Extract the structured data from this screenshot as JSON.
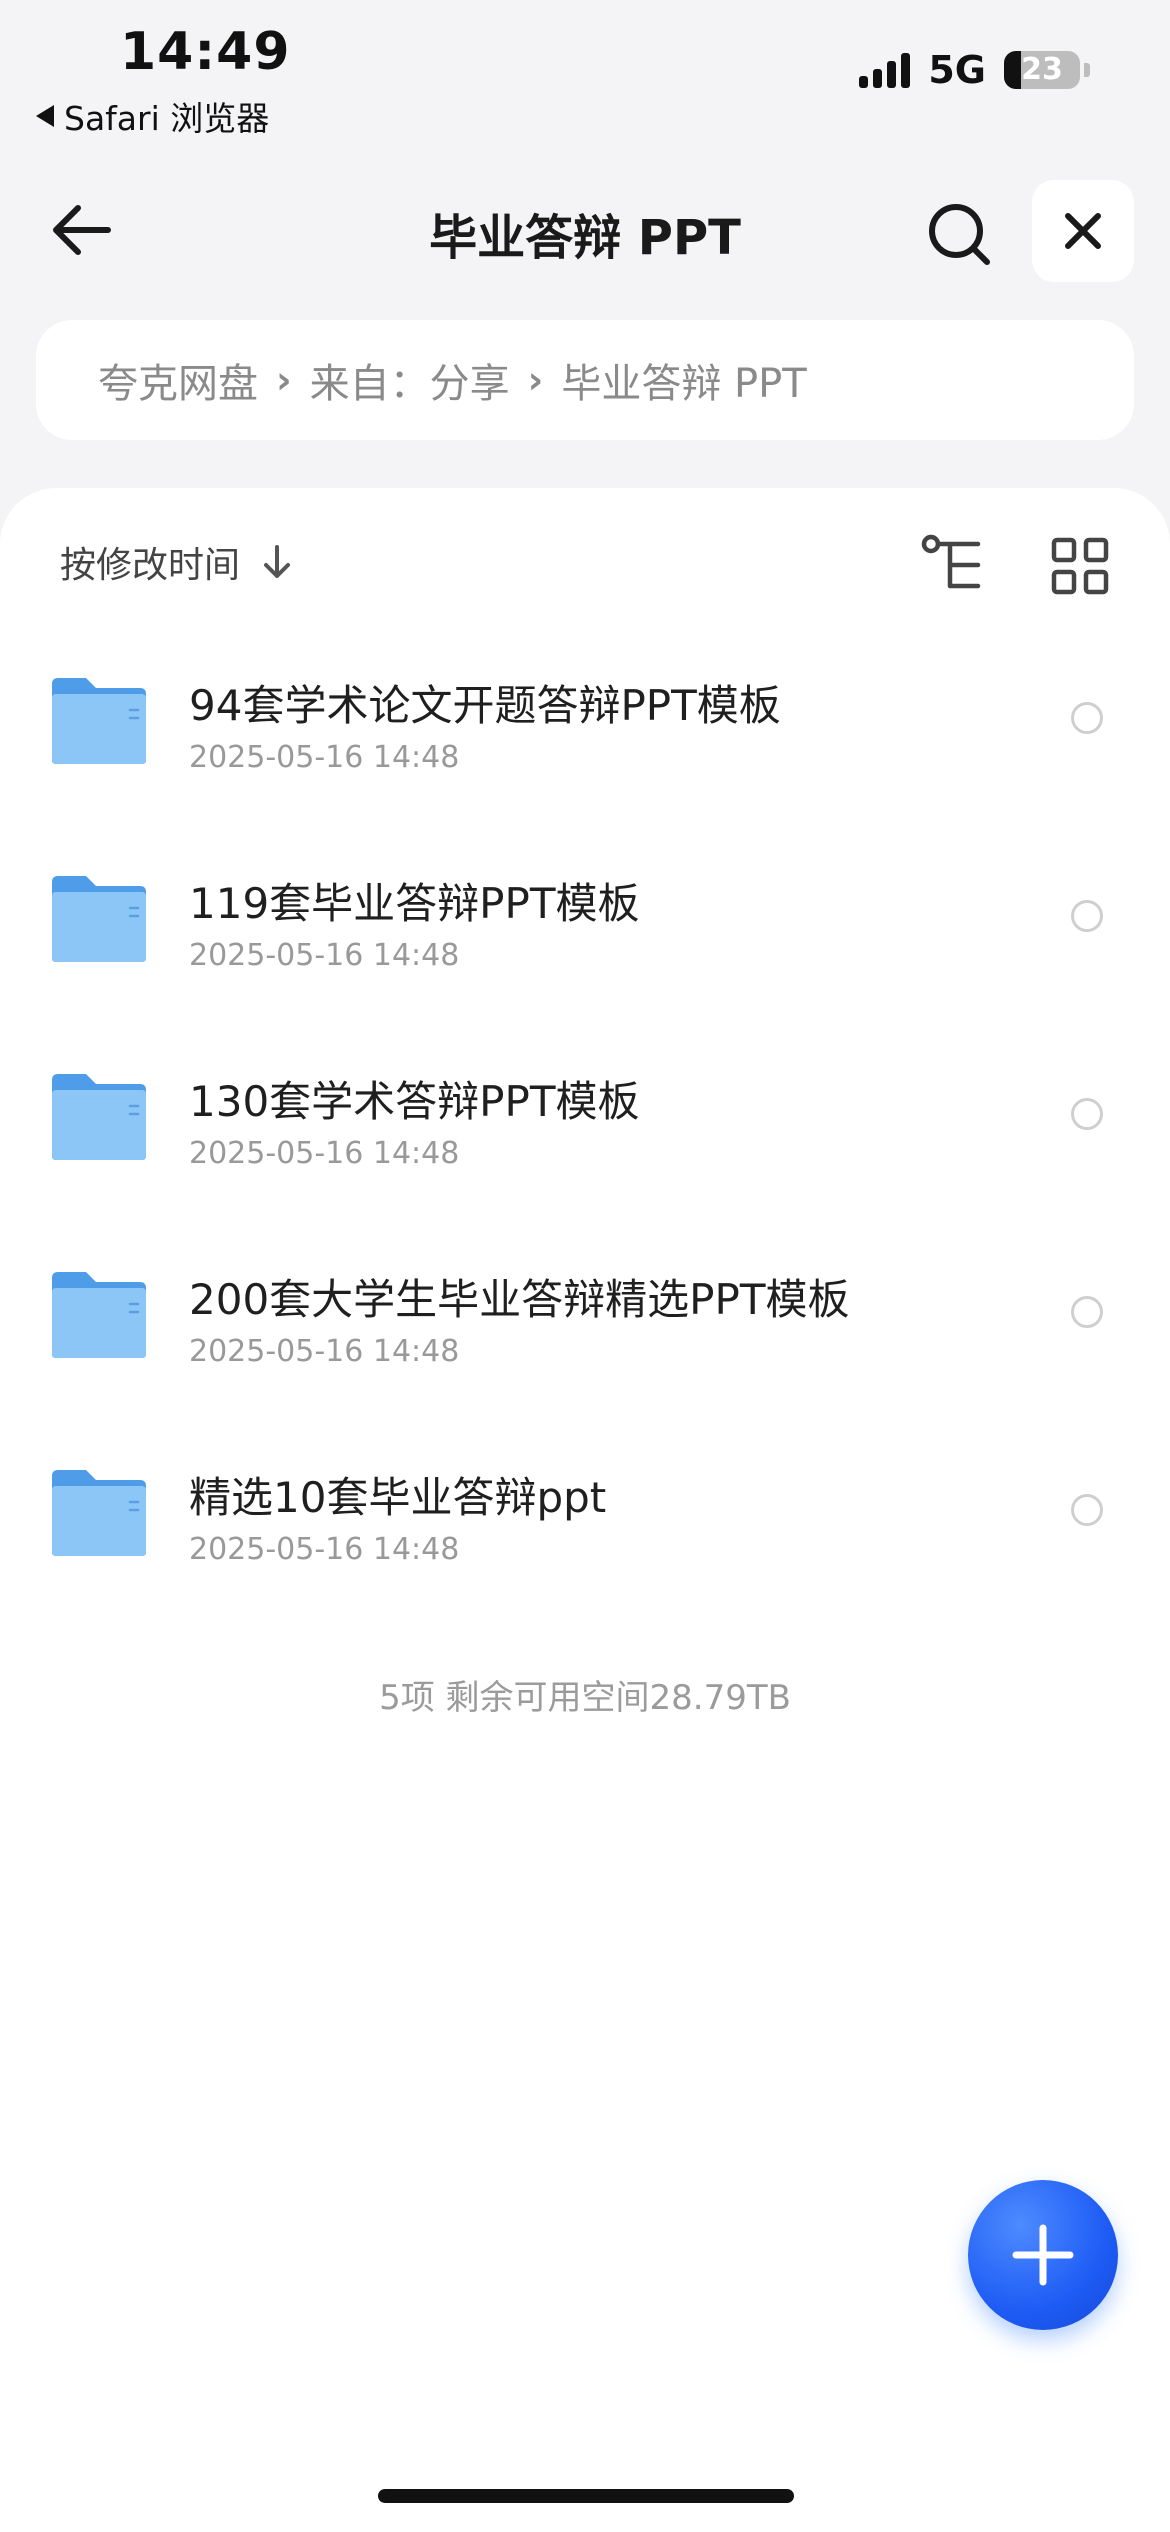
{
  "status": {
    "time": "14:49",
    "back_app": "Safari 浏览器",
    "network": "5G",
    "battery": "23",
    "battery_level": 0.23
  },
  "header": {
    "title": "毕业答辩 PPT",
    "icons": {
      "back": "arrow-left-icon",
      "search": "search-icon",
      "close": "close-icon"
    }
  },
  "breadcrumb": {
    "items": [
      "夸克网盘",
      "来自：分享",
      "毕业答辩 PPT"
    ],
    "separator_icon": "chevron-right-icon"
  },
  "toolbar": {
    "sort_label": "按修改时间",
    "sort_icon": "arrow-down-icon",
    "tree_icon": "tree-view-icon",
    "grid_icon": "grid-view-icon"
  },
  "files": [
    {
      "name": "94套学术论文开题答辩PPT模板",
      "date": "2025-05-16 14:48",
      "icon": "folder-icon"
    },
    {
      "name": "119套毕业答辩PPT模板",
      "date": "2025-05-16 14:48",
      "icon": "folder-icon"
    },
    {
      "name": "130套学术答辩PPT模板",
      "date": "2025-05-16 14:48",
      "icon": "folder-icon"
    },
    {
      "name": "200套大学生毕业答辩精选PPT模板",
      "date": "2025-05-16 14:48",
      "icon": "folder-icon"
    },
    {
      "name": "精选10套毕业答辩ppt",
      "date": "2025-05-16 14:48",
      "icon": "folder-icon"
    }
  ],
  "footer": {
    "summary": "5项 剩余可用空间28.79TB"
  },
  "fab": {
    "icon": "plus-icon"
  },
  "colors": {
    "accent": "#1e5cf5",
    "folder": "#5aa8f0",
    "background": "#f4f4f6"
  }
}
